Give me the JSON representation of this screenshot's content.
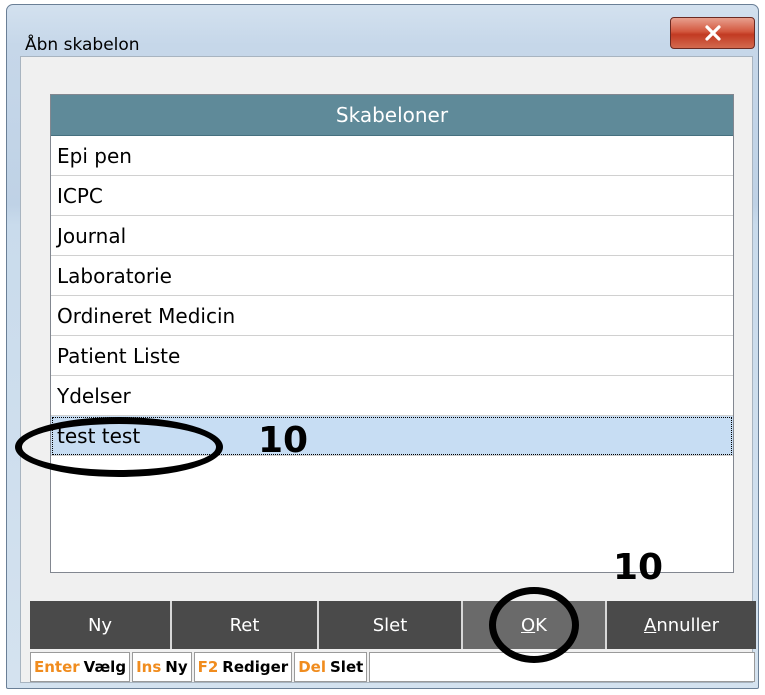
{
  "window": {
    "title": "Åbn skabelon"
  },
  "list": {
    "header": "Skabeloner",
    "items": [
      {
        "label": "Epi pen"
      },
      {
        "label": "ICPC"
      },
      {
        "label": "Journal"
      },
      {
        "label": "Laboratorie"
      },
      {
        "label": "Ordineret Medicin"
      },
      {
        "label": "Patient Liste"
      },
      {
        "label": "Ydelser"
      },
      {
        "label": "test test"
      }
    ],
    "selected_label": "test test"
  },
  "buttons": {
    "new": "Ny",
    "edit": "Ret",
    "delete": "Slet",
    "ok_ul": "O",
    "ok_rest": "K",
    "cancel_ul": "A",
    "cancel_rest": "nnuller"
  },
  "shortcuts": [
    {
      "key": "Enter",
      "action": "Vælg"
    },
    {
      "key": "Ins",
      "action": "Ny"
    },
    {
      "key": "F2",
      "action": "Rediger"
    },
    {
      "key": "Del",
      "action": "Slet"
    }
  ],
  "annotations": {
    "item_number": "10",
    "ok_number": "10"
  },
  "colors": {
    "header_bg": "#5f8a99",
    "selected_row": "#c7ddf3",
    "button_bg": "#4a4a4a",
    "shortcut_key": "#f08c1e",
    "close_button": "#c94a30"
  },
  "icons": {
    "close": "close-x-icon"
  }
}
